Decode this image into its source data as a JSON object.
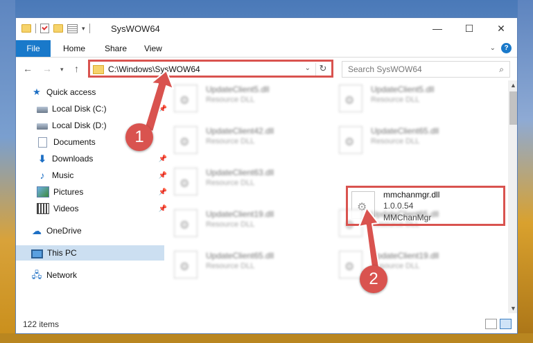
{
  "window": {
    "title": "SysWOW64"
  },
  "ribbon": {
    "tabs": [
      "File",
      "Home",
      "Share",
      "View"
    ]
  },
  "address": {
    "path": "C:\\Windows\\SysWOW64"
  },
  "search": {
    "placeholder": "Search SysWOW64"
  },
  "nav": {
    "items": [
      {
        "label": "Quick access",
        "icon": "star-icon"
      },
      {
        "label": "Local Disk (C:)",
        "icon": "drive-icon",
        "pinned": true
      },
      {
        "label": "Local Disk (D:)",
        "icon": "drive-icon"
      },
      {
        "label": "Documents",
        "icon": "document-icon"
      },
      {
        "label": "Downloads",
        "icon": "download-icon",
        "pinned": true
      },
      {
        "label": "Music",
        "icon": "music-icon",
        "pinned": true
      },
      {
        "label": "Pictures",
        "icon": "pictures-icon",
        "pinned": true
      },
      {
        "label": "Videos",
        "icon": "videos-icon",
        "pinned": true
      },
      {
        "label": "OneDrive",
        "icon": "cloud-icon"
      },
      {
        "label": "This PC",
        "icon": "computer-icon",
        "selected": true
      },
      {
        "label": "Network",
        "icon": "network-icon"
      }
    ]
  },
  "files": [
    {
      "name": "UpdateClient5.dll",
      "desc": "Resource DLL"
    },
    {
      "name": "UpdateClient5.dll",
      "desc": "Resource DLL"
    },
    {
      "name": "UpdateClient42.dll",
      "desc": "Resource DLL"
    },
    {
      "name": "UpdateClient65.dll",
      "desc": "Resource DLL"
    },
    {
      "name": "UpdateClient63.dll",
      "desc": "Resource DLL"
    },
    {
      "name": "mmchanmgr.dll",
      "version": "1.0.0.54",
      "product": "MMChanMgr"
    },
    {
      "name": "UpdateClient19.dll",
      "desc": "Resource DLL"
    },
    {
      "name": "UpdateClient65.dll",
      "desc": "Resource DLL"
    },
    {
      "name": "UpdateClient65.dll",
      "desc": "Resource DLL"
    },
    {
      "name": "UpdateClient19.dll",
      "desc": "Resource DLL"
    }
  ],
  "status": {
    "count": "122 items"
  },
  "annotations": {
    "step1": "1",
    "step2": "2",
    "color": "#d9534f"
  }
}
